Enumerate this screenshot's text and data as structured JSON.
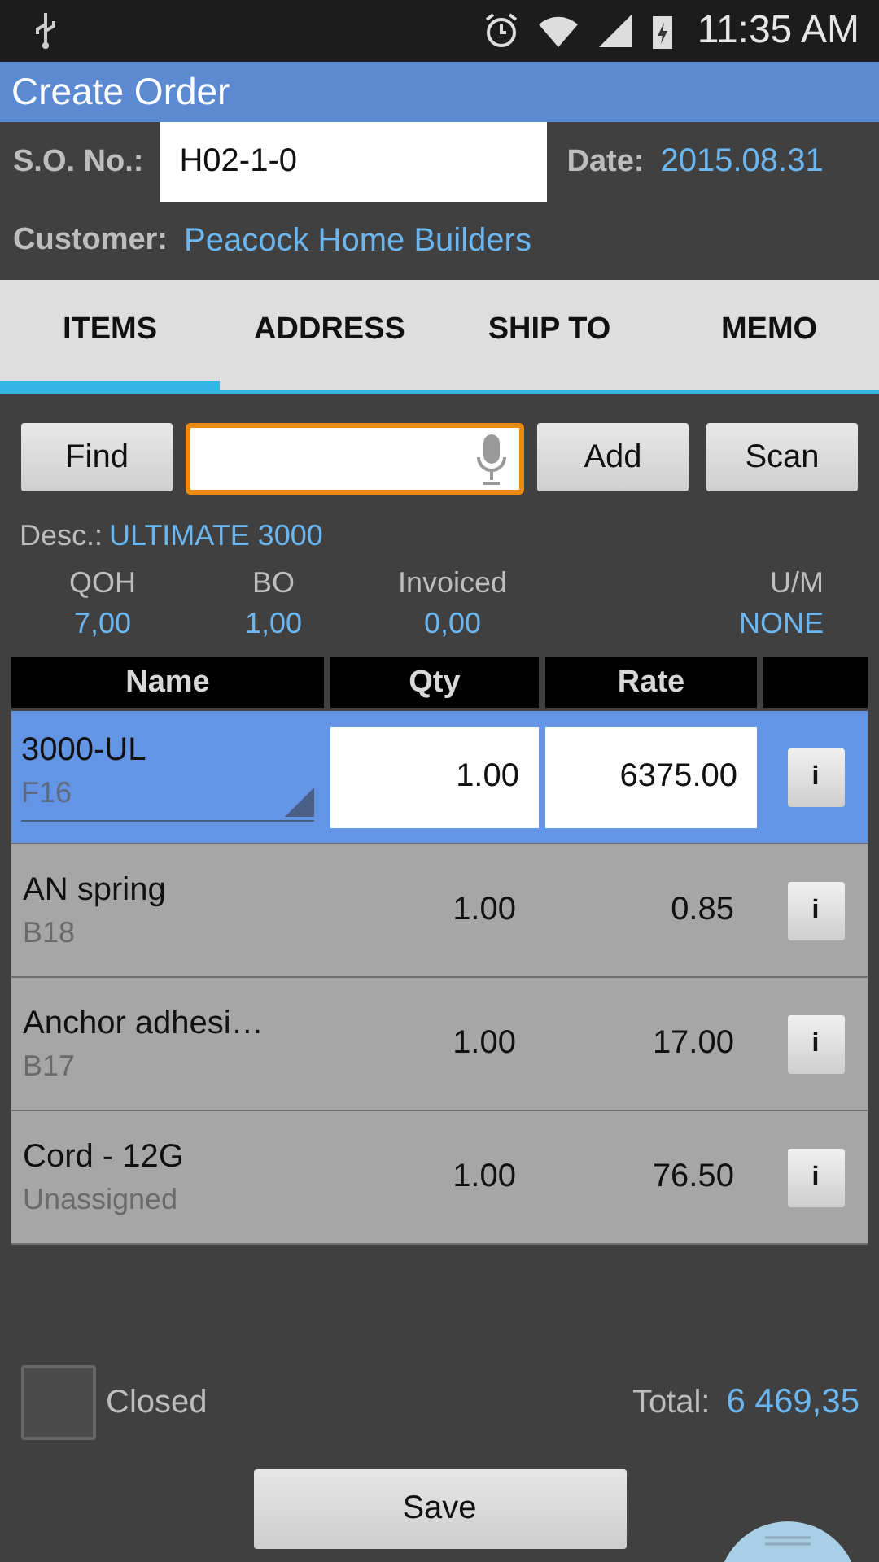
{
  "status_bar": {
    "time": "11:35 AM"
  },
  "window": {
    "title": "Create Order"
  },
  "header": {
    "so_label": "S.O. No.:",
    "so_value": "H02-1-0",
    "date_label": "Date:",
    "date_value": "2015.08.31",
    "customer_label": "Customer:",
    "customer_value": "Peacock Home Builders"
  },
  "tabs": [
    {
      "label": "ITEMS",
      "selected": true
    },
    {
      "label": "ADDRESS",
      "selected": false
    },
    {
      "label": "SHIP TO",
      "selected": false
    },
    {
      "label": "MEMO",
      "selected": false
    }
  ],
  "toolbar": {
    "find": "Find",
    "add": "Add",
    "scan": "Scan"
  },
  "description": {
    "label": "Desc.:",
    "value": "ULTIMATE 3000"
  },
  "stats": [
    {
      "label": "QOH",
      "value": "7,00"
    },
    {
      "label": "BO",
      "value": "1,00"
    },
    {
      "label": "Invoiced",
      "value": "0,00"
    },
    {
      "label": "U/M",
      "value": "NONE"
    }
  ],
  "table": {
    "columns": [
      "Name",
      "Qty",
      "Rate"
    ],
    "rows": [
      {
        "name": "3000-UL",
        "location": "F16",
        "qty": "1.00",
        "rate": "6375.00",
        "info": "i",
        "selected": true
      },
      {
        "name": "AN spring",
        "location": "B18",
        "qty": "1.00",
        "rate": "0.85",
        "info": "i",
        "selected": false
      },
      {
        "name": "Anchor adhesi…",
        "location": "B17",
        "qty": "1.00",
        "rate": "17.00",
        "info": "i",
        "selected": false
      },
      {
        "name": "Cord - 12G",
        "location": "Unassigned",
        "qty": "1.00",
        "rate": "76.50",
        "info": "i",
        "selected": false
      }
    ]
  },
  "footer": {
    "closed_label": "Closed",
    "closed": false,
    "total_label": "Total:",
    "total_value": "6 469,35",
    "save": "Save"
  }
}
